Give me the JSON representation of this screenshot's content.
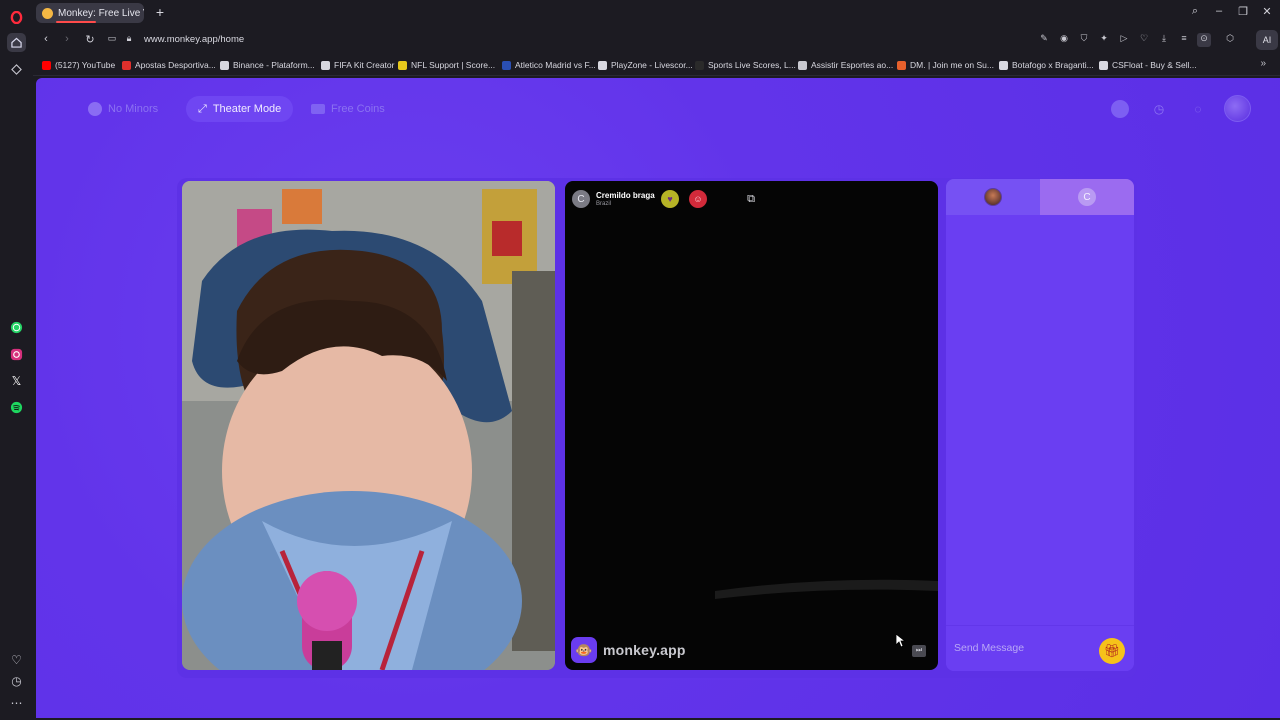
{
  "browser": {
    "tab_title": "Monkey: Free Live Vid",
    "url": "www.monkey.app/home",
    "ai_label": "AI",
    "bookmarks": [
      {
        "label": "(5127) YouTube",
        "color": "#ff0000"
      },
      {
        "label": "Apostas Desportiva...",
        "color": "#e0302c"
      },
      {
        "label": "Binance - Plataform...",
        "color": "#d8d8e0"
      },
      {
        "label": "FIFA Kit Creator",
        "color": "#d8d8e0"
      },
      {
        "label": "NFL Support | Score...",
        "color": "#e6c81c"
      },
      {
        "label": "Atletico Madrid vs F...",
        "color": "#2a4fb3"
      },
      {
        "label": "PlayZone - Livescor...",
        "color": "#d8d8e0"
      },
      {
        "label": "Sports Live Scores, L...",
        "color": "#2a2a2a"
      },
      {
        "label": "Assistir Esportes ao...",
        "color": "#c8c8d0"
      },
      {
        "label": "DM. | Join me on Su...",
        "color": "#e6602c"
      },
      {
        "label": "Botafogo x Braganti...",
        "color": "#d8d8e0"
      },
      {
        "label": "CSFloat - Buy & Sell...",
        "color": "#d8d8e0"
      }
    ]
  },
  "topnav": {
    "no_minors": "No Minors",
    "theater_mode": "Theater Mode",
    "free_coins": "Free Coins"
  },
  "remote": {
    "avatar_initial": "C",
    "name": "Cremildo braga",
    "country": "Brazil",
    "watermark": "monkey.app"
  },
  "chat": {
    "tab2_initial": "C",
    "placeholder": "Send Message"
  },
  "colors": {
    "page_bg": "#5d31e6",
    "accent": "#6a3ef2",
    "gift": "#f6c21a"
  }
}
